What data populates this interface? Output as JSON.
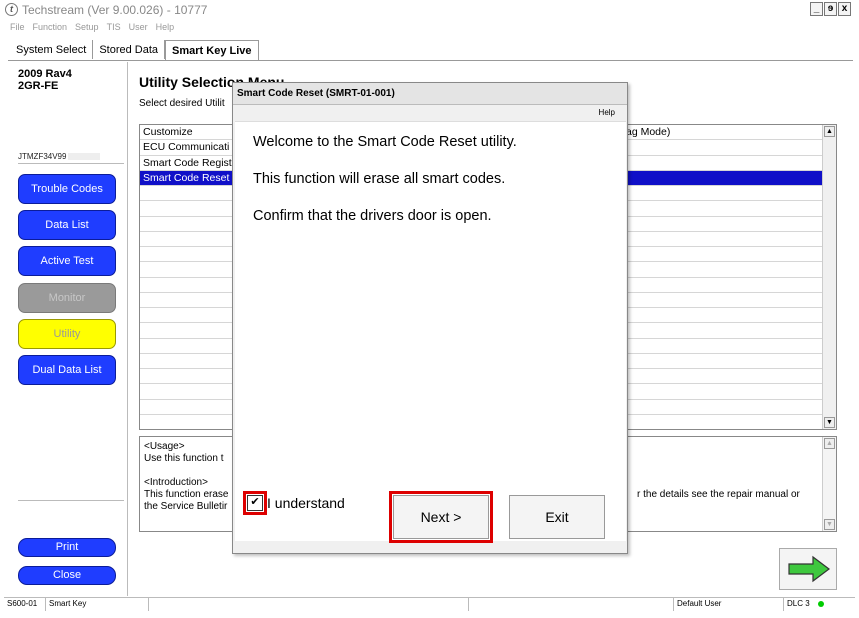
{
  "app": {
    "title": "Techstream (Ver 9.00.026) - 10777",
    "icon_glyph": "t",
    "window_buttons": [
      "_",
      "ɘ",
      "x"
    ]
  },
  "menu": [
    "File",
    "Function",
    "Setup",
    "TIS",
    "User",
    "Help"
  ],
  "tabs": [
    "System Select",
    "Stored Data",
    "Smart Key Live"
  ],
  "vehicle": {
    "model": "2009 Rav4",
    "engine": "2GR-FE",
    "vin_prefix": "JTMZF34V99"
  },
  "nav": {
    "trouble_codes": "Trouble Codes",
    "data_list": "Data List",
    "active_test": "Active Test",
    "monitor": "Monitor",
    "utility": "Utility",
    "dual_data_list": "Dual Data List",
    "print": "Print",
    "close": "Close"
  },
  "main": {
    "title": "Utility Selection Menu",
    "subtitle": "Select desired Utilit",
    "list_items": [
      "Customize",
      "ECU Communicati",
      "Smart Code Regist",
      "Smart Code Reset"
    ],
    "list_col2_text": "ag Mode)",
    "selected_index": 3,
    "scroll_up": "▲",
    "scroll_down": "▼"
  },
  "description": {
    "usage_header": "<Usage>",
    "usage_text": "Use this function t",
    "intro_header": "<Introduction>",
    "intro_line1": "This function erase",
    "intro_line2": "the Service Bulletir",
    "intro_right": "r the details see the repair manual or"
  },
  "dialog": {
    "title": "Smart Code Reset (SMRT-01-001)",
    "help": "Help",
    "line1": "Welcome to the Smart Code Reset utility.",
    "line2": "This function will erase all smart codes.",
    "line3": "Confirm that the drivers door is open.",
    "checkbox_label": "I understand",
    "checkbox_mark": "✔",
    "next": "Next >",
    "exit": "Exit"
  },
  "statusbar": {
    "code": "S600-01",
    "mode": "Smart Key",
    "user": "Default User",
    "dlc": "DLC 3"
  },
  "colors": {
    "nav_blue": "#1f3dff",
    "selected_yellow": "#ffff00",
    "list_selection": "#1010c8",
    "highlight_red": "#dd0000",
    "status_green": "#00cc00"
  }
}
